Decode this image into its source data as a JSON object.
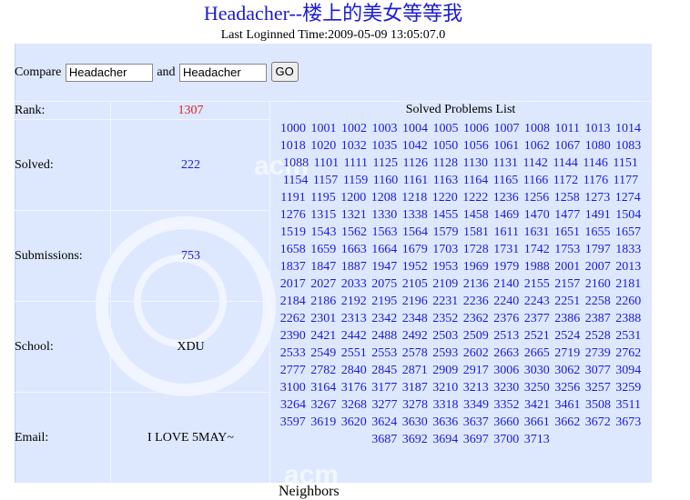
{
  "header": {
    "title": "Headacher--楼上的美女等等我",
    "last_login": "Last Loginned Time:2009-05-09 13:05:07.0"
  },
  "compare": {
    "label": "Compare",
    "user1": "Headacher",
    "and_label": "and",
    "user2": "Headacher",
    "go_label": "GO"
  },
  "stats": {
    "rank_label": "Rank:",
    "rank_value": "1307",
    "solved_label": "Solved:",
    "solved_value": "222",
    "submissions_label": "Submissions:",
    "submissions_value": "753",
    "school_label": "School:",
    "school_value": "XDU",
    "email_label": "Email:",
    "email_value": "I LOVE 5MAY~"
  },
  "problems_header": "Solved Problems List",
  "problems": [
    "1000",
    "1001",
    "1002",
    "1003",
    "1004",
    "1005",
    "1006",
    "1007",
    "1008",
    "1011",
    "1013",
    "1014",
    "1018",
    "1020",
    "1032",
    "1035",
    "1042",
    "1050",
    "1056",
    "1061",
    "1062",
    "1067",
    "1080",
    "1083",
    "1088",
    "1101",
    "1111",
    "1125",
    "1126",
    "1128",
    "1130",
    "1131",
    "1142",
    "1144",
    "1146",
    "1151",
    "1154",
    "1157",
    "1159",
    "1160",
    "1161",
    "1163",
    "1164",
    "1165",
    "1166",
    "1172",
    "1176",
    "1177",
    "1191",
    "1195",
    "1200",
    "1208",
    "1218",
    "1220",
    "1222",
    "1236",
    "1256",
    "1258",
    "1273",
    "1274",
    "1276",
    "1315",
    "1321",
    "1330",
    "1338",
    "1455",
    "1458",
    "1469",
    "1470",
    "1477",
    "1491",
    "1504",
    "1519",
    "1543",
    "1562",
    "1563",
    "1564",
    "1579",
    "1581",
    "1611",
    "1631",
    "1651",
    "1655",
    "1657",
    "1658",
    "1659",
    "1663",
    "1664",
    "1679",
    "1703",
    "1728",
    "1731",
    "1742",
    "1753",
    "1797",
    "1833",
    "1837",
    "1847",
    "1887",
    "1947",
    "1952",
    "1953",
    "1969",
    "1979",
    "1988",
    "2001",
    "2007",
    "2013",
    "2017",
    "2027",
    "2033",
    "2075",
    "2105",
    "2109",
    "2136",
    "2140",
    "2155",
    "2157",
    "2160",
    "2181",
    "2184",
    "2186",
    "2192",
    "2195",
    "2196",
    "2231",
    "2236",
    "2240",
    "2243",
    "2251",
    "2258",
    "2260",
    "2262",
    "2301",
    "2313",
    "2342",
    "2348",
    "2352",
    "2362",
    "2376",
    "2377",
    "2386",
    "2387",
    "2388",
    "2390",
    "2421",
    "2442",
    "2488",
    "2492",
    "2503",
    "2509",
    "2513",
    "2521",
    "2524",
    "2528",
    "2531",
    "2533",
    "2549",
    "2551",
    "2553",
    "2578",
    "2593",
    "2602",
    "2663",
    "2665",
    "2719",
    "2739",
    "2762",
    "2777",
    "2782",
    "2840",
    "2845",
    "2871",
    "2909",
    "2917",
    "3006",
    "3030",
    "3062",
    "3077",
    "3094",
    "3100",
    "3164",
    "3176",
    "3177",
    "3187",
    "3210",
    "3213",
    "3230",
    "3250",
    "3256",
    "3257",
    "3259",
    "3264",
    "3267",
    "3268",
    "3277",
    "3278",
    "3318",
    "3349",
    "3352",
    "3421",
    "3461",
    "3508",
    "3511",
    "3597",
    "3619",
    "3620",
    "3624",
    "3630",
    "3636",
    "3637",
    "3660",
    "3661",
    "3662",
    "3672",
    "3673",
    "3687",
    "3692",
    "3694",
    "3697",
    "3700",
    "3713"
  ],
  "footer": {
    "next_label": "Neighbors"
  },
  "colors": {
    "panel": "#dde8ff",
    "link": "#1b1bd6",
    "rank": "#e0201b"
  }
}
